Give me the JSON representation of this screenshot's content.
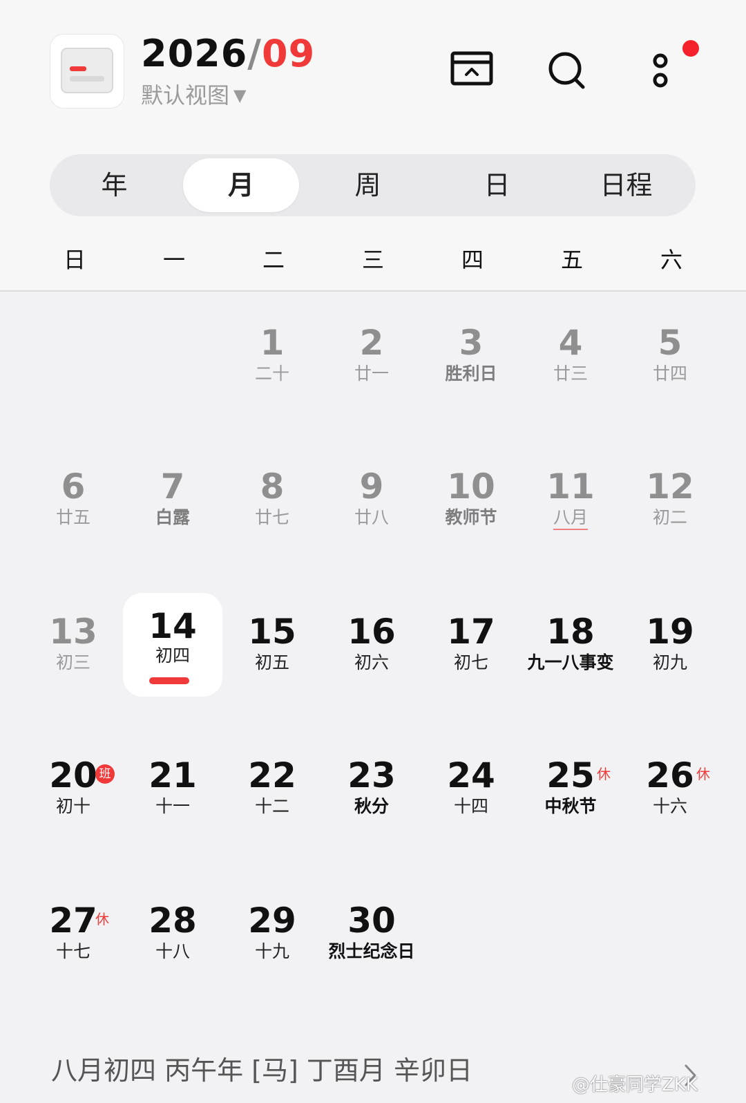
{
  "header": {
    "year": "2026",
    "slash": "/",
    "month": "09",
    "view_label": "默认视图",
    "view_caret": "▼"
  },
  "icons": {
    "app": "calendar-app-icon",
    "today": "today-return-icon",
    "search": "search-icon",
    "more": "more-icon",
    "colors": {
      "accent": "#f03a3a",
      "badge": "#f5222d"
    }
  },
  "tabs": [
    {
      "label": "年",
      "active": false
    },
    {
      "label": "月",
      "active": true
    },
    {
      "label": "周",
      "active": false
    },
    {
      "label": "日",
      "active": false
    },
    {
      "label": "日程",
      "active": false
    }
  ],
  "weekdays": [
    "日",
    "一",
    "二",
    "三",
    "四",
    "五",
    "六"
  ],
  "weeks": [
    [
      null,
      null,
      {
        "day": "1",
        "lunar": "二十",
        "muted": true
      },
      {
        "day": "2",
        "lunar": "廿一",
        "muted": true
      },
      {
        "day": "3",
        "lunar": "胜利日",
        "muted": true,
        "festival": true
      },
      {
        "day": "4",
        "lunar": "廿三",
        "muted": true
      },
      {
        "day": "5",
        "lunar": "廿四",
        "muted": true
      }
    ],
    [
      {
        "day": "6",
        "lunar": "廿五",
        "muted": true
      },
      {
        "day": "7",
        "lunar": "白露",
        "muted": true,
        "festival": true
      },
      {
        "day": "8",
        "lunar": "廿七",
        "muted": true
      },
      {
        "day": "9",
        "lunar": "廿八",
        "muted": true
      },
      {
        "day": "10",
        "lunar": "教师节",
        "muted": true,
        "festival": true
      },
      {
        "day": "11",
        "lunar": "八月",
        "muted": true,
        "month_mark": true
      },
      {
        "day": "12",
        "lunar": "初二",
        "muted": true
      }
    ],
    [
      {
        "day": "13",
        "lunar": "初三",
        "muted": true
      },
      {
        "day": "14",
        "lunar": "初四",
        "today": true
      },
      {
        "day": "15",
        "lunar": "初五"
      },
      {
        "day": "16",
        "lunar": "初六"
      },
      {
        "day": "17",
        "lunar": "初七"
      },
      {
        "day": "18",
        "lunar": "九一八事变",
        "festival": true
      },
      {
        "day": "19",
        "lunar": "初九"
      }
    ],
    [
      {
        "day": "20",
        "lunar": "初十",
        "work": "班"
      },
      {
        "day": "21",
        "lunar": "十一"
      },
      {
        "day": "22",
        "lunar": "十二"
      },
      {
        "day": "23",
        "lunar": "秋分",
        "festival": true
      },
      {
        "day": "24",
        "lunar": "十四"
      },
      {
        "day": "25",
        "lunar": "中秋节",
        "festival": true,
        "rest": "休"
      },
      {
        "day": "26",
        "lunar": "十六",
        "rest": "休"
      }
    ],
    [
      {
        "day": "27",
        "lunar": "十七",
        "rest": "休"
      },
      {
        "day": "28",
        "lunar": "十八"
      },
      {
        "day": "29",
        "lunar": "十九"
      },
      {
        "day": "30",
        "lunar": "烈士纪念日",
        "festival": true
      },
      null,
      null,
      null
    ]
  ],
  "footer": {
    "lunar_info": "八月初四 丙午年 [马] 丁酉月 辛卯日",
    "chevron": "chevron-right-icon"
  },
  "watermark": "@仕豪同学ZKK"
}
